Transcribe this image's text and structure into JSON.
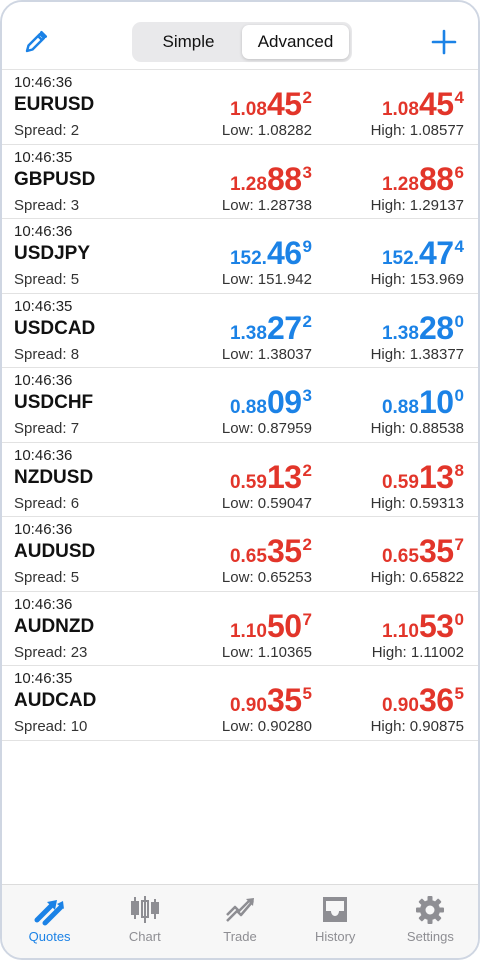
{
  "header": {
    "segments": [
      "Simple",
      "Advanced"
    ],
    "active_segment": "Advanced",
    "edit_icon": "pencil-icon",
    "add_icon": "plus-icon"
  },
  "colors": {
    "accent": "#1b82e6",
    "down": "#e2352a",
    "up": "#1b82e6"
  },
  "quotes": [
    {
      "time": "10:46:36",
      "symbol": "EURUSD",
      "spread": "Spread: 2",
      "bid": {
        "prefix": "1.08",
        "big": "45",
        "sup": "2"
      },
      "ask": {
        "prefix": "1.08",
        "big": "45",
        "sup": "4"
      },
      "color": "red",
      "low": "Low: 1.08282",
      "high": "High: 1.08577"
    },
    {
      "time": "10:46:35",
      "symbol": "GBPUSD",
      "spread": "Spread: 3",
      "bid": {
        "prefix": "1.28",
        "big": "88",
        "sup": "3"
      },
      "ask": {
        "prefix": "1.28",
        "big": "88",
        "sup": "6"
      },
      "color": "red",
      "low": "Low: 1.28738",
      "high": "High: 1.29137"
    },
    {
      "time": "10:46:36",
      "symbol": "USDJPY",
      "spread": "Spread: 5",
      "bid": {
        "prefix": "152.",
        "big": "46",
        "sup": "9"
      },
      "ask": {
        "prefix": "152.",
        "big": "47",
        "sup": "4"
      },
      "color": "blue",
      "low": "Low: 151.942",
      "high": "High: 153.969"
    },
    {
      "time": "10:46:35",
      "symbol": "USDCAD",
      "spread": "Spread: 8",
      "bid": {
        "prefix": "1.38",
        "big": "27",
        "sup": "2"
      },
      "ask": {
        "prefix": "1.38",
        "big": "28",
        "sup": "0"
      },
      "color": "blue",
      "low": "Low: 1.38037",
      "high": "High: 1.38377"
    },
    {
      "time": "10:46:36",
      "symbol": "USDCHF",
      "spread": "Spread: 7",
      "bid": {
        "prefix": "0.88",
        "big": "09",
        "sup": "3"
      },
      "ask": {
        "prefix": "0.88",
        "big": "10",
        "sup": "0"
      },
      "color": "blue",
      "low": "Low: 0.87959",
      "high": "High: 0.88538"
    },
    {
      "time": "10:46:36",
      "symbol": "NZDUSD",
      "spread": "Spread: 6",
      "bid": {
        "prefix": "0.59",
        "big": "13",
        "sup": "2"
      },
      "ask": {
        "prefix": "0.59",
        "big": "13",
        "sup": "8"
      },
      "color": "red",
      "low": "Low: 0.59047",
      "high": "High: 0.59313"
    },
    {
      "time": "10:46:36",
      "symbol": "AUDUSD",
      "spread": "Spread: 5",
      "bid": {
        "prefix": "0.65",
        "big": "35",
        "sup": "2"
      },
      "ask": {
        "prefix": "0.65",
        "big": "35",
        "sup": "7"
      },
      "color": "red",
      "low": "Low: 0.65253",
      "high": "High: 0.65822"
    },
    {
      "time": "10:46:36",
      "symbol": "AUDNZD",
      "spread": "Spread: 23",
      "bid": {
        "prefix": "1.10",
        "big": "50",
        "sup": "7"
      },
      "ask": {
        "prefix": "1.10",
        "big": "53",
        "sup": "0"
      },
      "color": "red",
      "low": "Low: 1.10365",
      "high": "High: 1.11002"
    },
    {
      "time": "10:46:35",
      "symbol": "AUDCAD",
      "spread": "Spread: 10",
      "bid": {
        "prefix": "0.90",
        "big": "35",
        "sup": "5"
      },
      "ask": {
        "prefix": "0.90",
        "big": "36",
        "sup": "5"
      },
      "color": "red",
      "low": "Low: 0.90280",
      "high": "High: 0.90875"
    }
  ],
  "tabs": [
    {
      "label": "Quotes",
      "icon": "quotes-arrows-icon",
      "active": true
    },
    {
      "label": "Chart",
      "icon": "candlestick-chart-icon",
      "active": false
    },
    {
      "label": "Trade",
      "icon": "trade-trend-icon",
      "active": false
    },
    {
      "label": "History",
      "icon": "inbox-tray-icon",
      "active": false
    },
    {
      "label": "Settings",
      "icon": "gear-icon",
      "active": false
    }
  ]
}
